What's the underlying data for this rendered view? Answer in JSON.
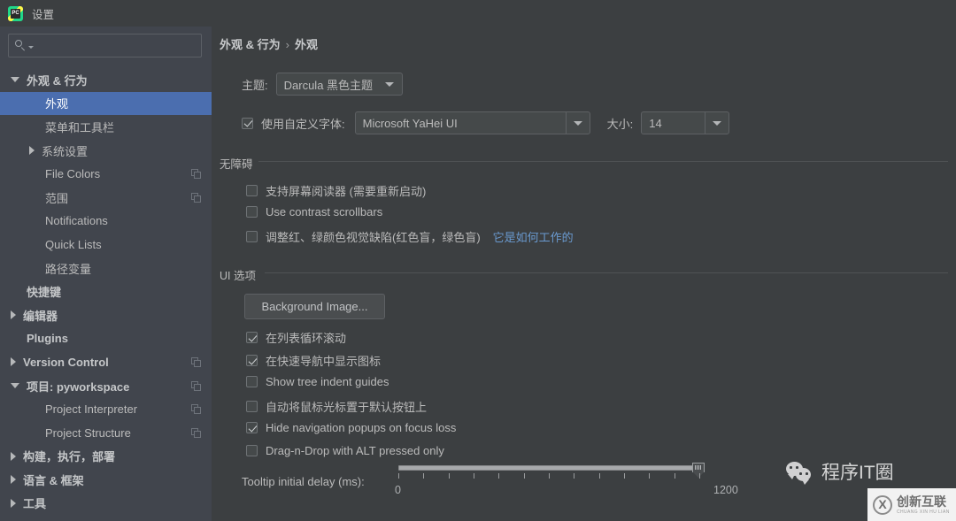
{
  "window": {
    "title": "设置",
    "app_icon": "pycharm-icon",
    "icon_letters": "PC"
  },
  "sidebar": {
    "search": {
      "value": "",
      "placeholder": "",
      "icon": "search-icon"
    },
    "items": [
      {
        "label": "外观 & 行为",
        "indent": 0,
        "twisty": "down",
        "bold": true,
        "selected": false,
        "copy": false
      },
      {
        "label": "外观",
        "indent": 1,
        "twisty": "none",
        "bold": false,
        "selected": true,
        "copy": false
      },
      {
        "label": "菜单和工具栏",
        "indent": 1,
        "twisty": "none",
        "bold": false,
        "selected": false,
        "copy": false
      },
      {
        "label": "系统设置",
        "indent": 1,
        "twisty": "right",
        "bold": false,
        "selected": false,
        "copy": false
      },
      {
        "label": "File Colors",
        "indent": 1,
        "twisty": "none",
        "bold": false,
        "selected": false,
        "copy": true
      },
      {
        "label": "范围",
        "indent": 1,
        "twisty": "none",
        "bold": false,
        "selected": false,
        "copy": true
      },
      {
        "label": "Notifications",
        "indent": 1,
        "twisty": "none",
        "bold": false,
        "selected": false,
        "copy": false
      },
      {
        "label": "Quick Lists",
        "indent": 1,
        "twisty": "none",
        "bold": false,
        "selected": false,
        "copy": false
      },
      {
        "label": "路径变量",
        "indent": 1,
        "twisty": "none",
        "bold": false,
        "selected": false,
        "copy": false
      },
      {
        "label": "快捷键",
        "indent": 0,
        "twisty": "none",
        "bold": true,
        "selected": false,
        "copy": false
      },
      {
        "label": "编辑器",
        "indent": 0,
        "twisty": "right",
        "bold": true,
        "selected": false,
        "copy": false
      },
      {
        "label": "Plugins",
        "indent": 0,
        "twisty": "none",
        "bold": true,
        "selected": false,
        "copy": false
      },
      {
        "label": "Version Control",
        "indent": 0,
        "twisty": "right",
        "bold": true,
        "selected": false,
        "copy": true
      },
      {
        "label": "项目: pyworkspace",
        "indent": 0,
        "twisty": "down",
        "bold": true,
        "selected": false,
        "copy": true
      },
      {
        "label": "Project Interpreter",
        "indent": 1,
        "twisty": "none",
        "bold": false,
        "selected": false,
        "copy": true
      },
      {
        "label": "Project Structure",
        "indent": 1,
        "twisty": "none",
        "bold": false,
        "selected": false,
        "copy": true
      },
      {
        "label": "构建，执行，部署",
        "indent": 0,
        "twisty": "right",
        "bold": true,
        "selected": false,
        "copy": false
      },
      {
        "label": "语言 & 框架",
        "indent": 0,
        "twisty": "right",
        "bold": true,
        "selected": false,
        "copy": false
      },
      {
        "label": "工具",
        "indent": 0,
        "twisty": "right",
        "bold": true,
        "selected": false,
        "copy": false
      }
    ]
  },
  "main": {
    "breadcrumb": {
      "parent": "外观 & 行为",
      "separator": "›",
      "current": "外观"
    },
    "theme": {
      "label": "主题:",
      "value": "Darcula 黑色主题"
    },
    "font": {
      "checkbox_label": "使用自定义字体:",
      "checked": true,
      "value": "Microsoft YaHei UI",
      "size_label": "大小:",
      "size_value": "14"
    },
    "accessibility": {
      "title": "无障碍",
      "options": [
        {
          "label": "支持屏幕阅读器 (需要重新启动)",
          "checked": false,
          "link": ""
        },
        {
          "label": "Use contrast scrollbars",
          "checked": false,
          "link": ""
        },
        {
          "label": "调整红、绿颜色视觉缺陷(红色盲，绿色盲)",
          "checked": false,
          "link": "它是如何工作的"
        }
      ]
    },
    "ui_options": {
      "title": "UI 选项",
      "background_image_button": "Background Image...",
      "options": [
        {
          "label": "在列表循环滚动",
          "checked": true
        },
        {
          "label": "在快速导航中显示图标",
          "checked": true
        },
        {
          "label": "Show tree indent guides",
          "checked": false
        },
        {
          "label": "自动将鼠标光标置于默认按钮上",
          "checked": false
        },
        {
          "label": "Hide navigation popups on focus loss",
          "checked": true
        },
        {
          "label": "Drag-n-Drop with ALT pressed only",
          "checked": false
        }
      ]
    },
    "tooltip_slider": {
      "label": "Tooltip initial delay (ms):",
      "min": 0,
      "max": 1200,
      "value": 1200,
      "min_label": "0",
      "max_label": "1200",
      "tick_count": 13
    }
  },
  "watermarks": {
    "wechat": {
      "icon": "wechat-icon",
      "text": "程序IT圈"
    },
    "chuangxin": {
      "logo_letter": "X",
      "main": "创新互联",
      "sub": "CHUANG XIN HU LIAN"
    }
  },
  "colors": {
    "window_bg": "#3c3f41",
    "sidebar_bg": "#41454d",
    "selection": "#4b6eaf",
    "text": "#bbbbbb",
    "link": "#6a9ad0",
    "border": "#5e6164"
  }
}
